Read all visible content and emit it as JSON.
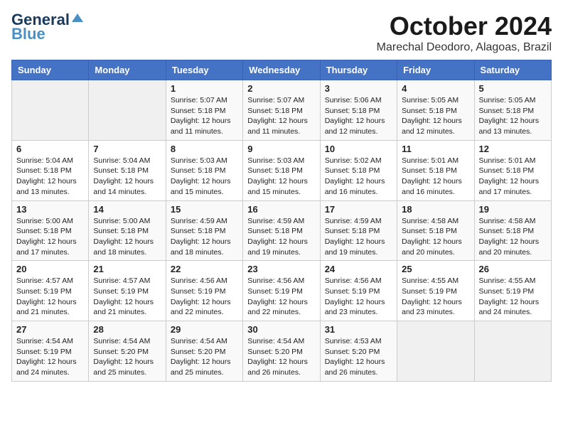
{
  "logo": {
    "line1": "General",
    "line2": "Blue"
  },
  "title": "October 2024",
  "location": "Marechal Deodoro, Alagoas, Brazil",
  "weekdays": [
    "Sunday",
    "Monday",
    "Tuesday",
    "Wednesday",
    "Thursday",
    "Friday",
    "Saturday"
  ],
  "weeks": [
    [
      {
        "day": "",
        "info": ""
      },
      {
        "day": "",
        "info": ""
      },
      {
        "day": "1",
        "info": "Sunrise: 5:07 AM\nSunset: 5:18 PM\nDaylight: 12 hours and 11 minutes."
      },
      {
        "day": "2",
        "info": "Sunrise: 5:07 AM\nSunset: 5:18 PM\nDaylight: 12 hours and 11 minutes."
      },
      {
        "day": "3",
        "info": "Sunrise: 5:06 AM\nSunset: 5:18 PM\nDaylight: 12 hours and 12 minutes."
      },
      {
        "day": "4",
        "info": "Sunrise: 5:05 AM\nSunset: 5:18 PM\nDaylight: 12 hours and 12 minutes."
      },
      {
        "day": "5",
        "info": "Sunrise: 5:05 AM\nSunset: 5:18 PM\nDaylight: 12 hours and 13 minutes."
      }
    ],
    [
      {
        "day": "6",
        "info": "Sunrise: 5:04 AM\nSunset: 5:18 PM\nDaylight: 12 hours and 13 minutes."
      },
      {
        "day": "7",
        "info": "Sunrise: 5:04 AM\nSunset: 5:18 PM\nDaylight: 12 hours and 14 minutes."
      },
      {
        "day": "8",
        "info": "Sunrise: 5:03 AM\nSunset: 5:18 PM\nDaylight: 12 hours and 15 minutes."
      },
      {
        "day": "9",
        "info": "Sunrise: 5:03 AM\nSunset: 5:18 PM\nDaylight: 12 hours and 15 minutes."
      },
      {
        "day": "10",
        "info": "Sunrise: 5:02 AM\nSunset: 5:18 PM\nDaylight: 12 hours and 16 minutes."
      },
      {
        "day": "11",
        "info": "Sunrise: 5:01 AM\nSunset: 5:18 PM\nDaylight: 12 hours and 16 minutes."
      },
      {
        "day": "12",
        "info": "Sunrise: 5:01 AM\nSunset: 5:18 PM\nDaylight: 12 hours and 17 minutes."
      }
    ],
    [
      {
        "day": "13",
        "info": "Sunrise: 5:00 AM\nSunset: 5:18 PM\nDaylight: 12 hours and 17 minutes."
      },
      {
        "day": "14",
        "info": "Sunrise: 5:00 AM\nSunset: 5:18 PM\nDaylight: 12 hours and 18 minutes."
      },
      {
        "day": "15",
        "info": "Sunrise: 4:59 AM\nSunset: 5:18 PM\nDaylight: 12 hours and 18 minutes."
      },
      {
        "day": "16",
        "info": "Sunrise: 4:59 AM\nSunset: 5:18 PM\nDaylight: 12 hours and 19 minutes."
      },
      {
        "day": "17",
        "info": "Sunrise: 4:59 AM\nSunset: 5:18 PM\nDaylight: 12 hours and 19 minutes."
      },
      {
        "day": "18",
        "info": "Sunrise: 4:58 AM\nSunset: 5:18 PM\nDaylight: 12 hours and 20 minutes."
      },
      {
        "day": "19",
        "info": "Sunrise: 4:58 AM\nSunset: 5:18 PM\nDaylight: 12 hours and 20 minutes."
      }
    ],
    [
      {
        "day": "20",
        "info": "Sunrise: 4:57 AM\nSunset: 5:19 PM\nDaylight: 12 hours and 21 minutes."
      },
      {
        "day": "21",
        "info": "Sunrise: 4:57 AM\nSunset: 5:19 PM\nDaylight: 12 hours and 21 minutes."
      },
      {
        "day": "22",
        "info": "Sunrise: 4:56 AM\nSunset: 5:19 PM\nDaylight: 12 hours and 22 minutes."
      },
      {
        "day": "23",
        "info": "Sunrise: 4:56 AM\nSunset: 5:19 PM\nDaylight: 12 hours and 22 minutes."
      },
      {
        "day": "24",
        "info": "Sunrise: 4:56 AM\nSunset: 5:19 PM\nDaylight: 12 hours and 23 minutes."
      },
      {
        "day": "25",
        "info": "Sunrise: 4:55 AM\nSunset: 5:19 PM\nDaylight: 12 hours and 23 minutes."
      },
      {
        "day": "26",
        "info": "Sunrise: 4:55 AM\nSunset: 5:19 PM\nDaylight: 12 hours and 24 minutes."
      }
    ],
    [
      {
        "day": "27",
        "info": "Sunrise: 4:54 AM\nSunset: 5:19 PM\nDaylight: 12 hours and 24 minutes."
      },
      {
        "day": "28",
        "info": "Sunrise: 4:54 AM\nSunset: 5:20 PM\nDaylight: 12 hours and 25 minutes."
      },
      {
        "day": "29",
        "info": "Sunrise: 4:54 AM\nSunset: 5:20 PM\nDaylight: 12 hours and 25 minutes."
      },
      {
        "day": "30",
        "info": "Sunrise: 4:54 AM\nSunset: 5:20 PM\nDaylight: 12 hours and 26 minutes."
      },
      {
        "day": "31",
        "info": "Sunrise: 4:53 AM\nSunset: 5:20 PM\nDaylight: 12 hours and 26 minutes."
      },
      {
        "day": "",
        "info": ""
      },
      {
        "day": "",
        "info": ""
      }
    ]
  ]
}
